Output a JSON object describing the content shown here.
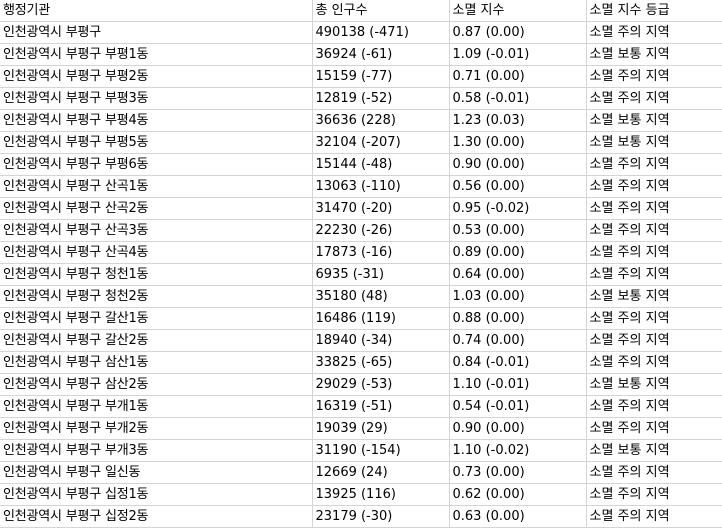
{
  "sheet": {
    "header": [
      "행정기관",
      "총 인구수",
      "소멸 지수",
      "소멸 지수 등급"
    ],
    "rows": [
      [
        "인천광역시 부평구",
        "490138 (-471)",
        "0.87 (0.00)",
        "소멸 주의 지역"
      ],
      [
        "인천광역시 부평구 부평1동",
        "36924 (-61)",
        "1.09 (-0.01)",
        "소멸 보통 지역"
      ],
      [
        "인천광역시 부평구 부평2동",
        "15159 (-77)",
        "0.71 (0.00)",
        "소멸 주의 지역"
      ],
      [
        "인천광역시 부평구 부평3동",
        "12819 (-52)",
        "0.58 (-0.01)",
        "소멸 주의 지역"
      ],
      [
        "인천광역시 부평구 부평4동",
        "36636 (228)",
        "1.23 (0.03)",
        "소멸 보통 지역"
      ],
      [
        "인천광역시 부평구 부평5동",
        "32104 (-207)",
        "1.30 (0.00)",
        "소멸 보통 지역"
      ],
      [
        "인천광역시 부평구 부평6동",
        "15144 (-48)",
        "0.90 (0.00)",
        "소멸 주의 지역"
      ],
      [
        "인천광역시 부평구 산곡1동",
        "13063 (-110)",
        "0.56 (0.00)",
        "소멸 주의 지역"
      ],
      [
        "인천광역시 부평구 산곡2동",
        "31470 (-20)",
        "0.95 (-0.02)",
        "소멸 주의 지역"
      ],
      [
        "인천광역시 부평구 산곡3동",
        "22230 (-26)",
        "0.53 (0.00)",
        "소멸 주의 지역"
      ],
      [
        "인천광역시 부평구 산곡4동",
        "17873 (-16)",
        "0.89 (0.00)",
        "소멸 주의 지역"
      ],
      [
        "인천광역시 부평구 청천1동",
        "6935 (-31)",
        "0.64 (0.00)",
        "소멸 주의 지역"
      ],
      [
        "인천광역시 부평구 청천2동",
        "35180 (48)",
        "1.03 (0.00)",
        "소멸 보통 지역"
      ],
      [
        "인천광역시 부평구 갈산1동",
        "16486 (119)",
        "0.88 (0.00)",
        "소멸 주의 지역"
      ],
      [
        "인천광역시 부평구 갈산2동",
        "18940 (-34)",
        "0.74 (0.00)",
        "소멸 주의 지역"
      ],
      [
        "인천광역시 부평구 삼산1동",
        "33825 (-65)",
        "0.84 (-0.01)",
        "소멸 주의 지역"
      ],
      [
        "인천광역시 부평구 삼산2동",
        "29029 (-53)",
        "1.10 (-0.01)",
        "소멸 보통 지역"
      ],
      [
        "인천광역시 부평구 부개1동",
        "16319 (-51)",
        "0.54 (-0.01)",
        "소멸 주의 지역"
      ],
      [
        "인천광역시 부평구 부개2동",
        "19039 (29)",
        "0.90 (0.00)",
        "소멸 주의 지역"
      ],
      [
        "인천광역시 부평구 부개3동",
        "31190 (-154)",
        "1.10 (-0.02)",
        "소멸 보통 지역"
      ],
      [
        "인천광역시 부평구 일신동",
        "12669 (24)",
        "0.73 (0.00)",
        "소멸 주의 지역"
      ],
      [
        "인천광역시 부평구 십정1동",
        "13925 (116)",
        "0.62 (0.00)",
        "소멸 주의 지역"
      ],
      [
        "인천광역시 부평구 십정2동",
        "23179 (-30)",
        "0.63 (0.00)",
        "소멸 주의 지역"
      ]
    ]
  },
  "colors": {
    "grid": "#d4d4d4",
    "text": "#000000",
    "background": "#ffffff"
  }
}
